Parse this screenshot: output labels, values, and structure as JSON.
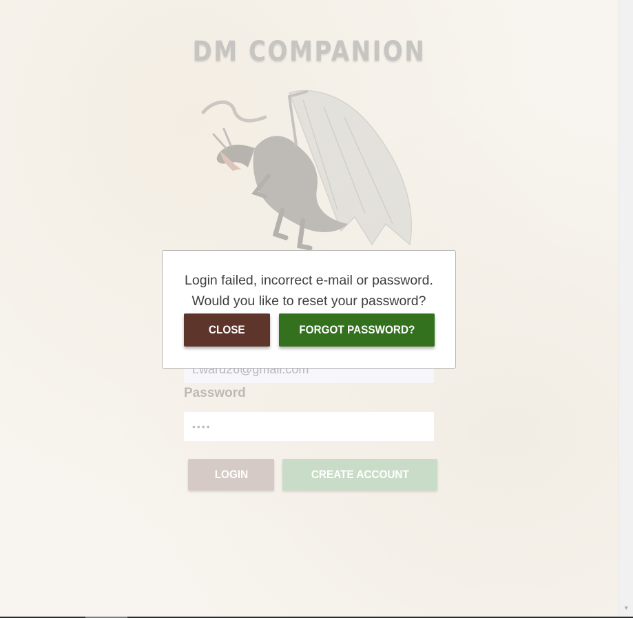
{
  "app": {
    "title": "DM COMPANION"
  },
  "login_form": {
    "email_value": "t.ward26@gmail.com",
    "password_label": "Password",
    "password_value": "••••",
    "login_label": "LOGIN",
    "create_account_label": "CREATE ACCOUNT"
  },
  "modal": {
    "line1": "Login failed, incorrect e-mail or password.",
    "line2": "Would you like to reset your password?",
    "close_label": "CLOSE",
    "forgot_label": "FORGOT PASSWORD?"
  },
  "colors": {
    "close_button": "#5e352a",
    "forgot_button": "#33711f",
    "login_button_dimmed": "#d6cac7",
    "create_button_dimmed": "#c9dcc7"
  },
  "icons": {
    "scroll_down": "scroll-down-arrow-icon",
    "logo_art": "dragon-illustration"
  }
}
